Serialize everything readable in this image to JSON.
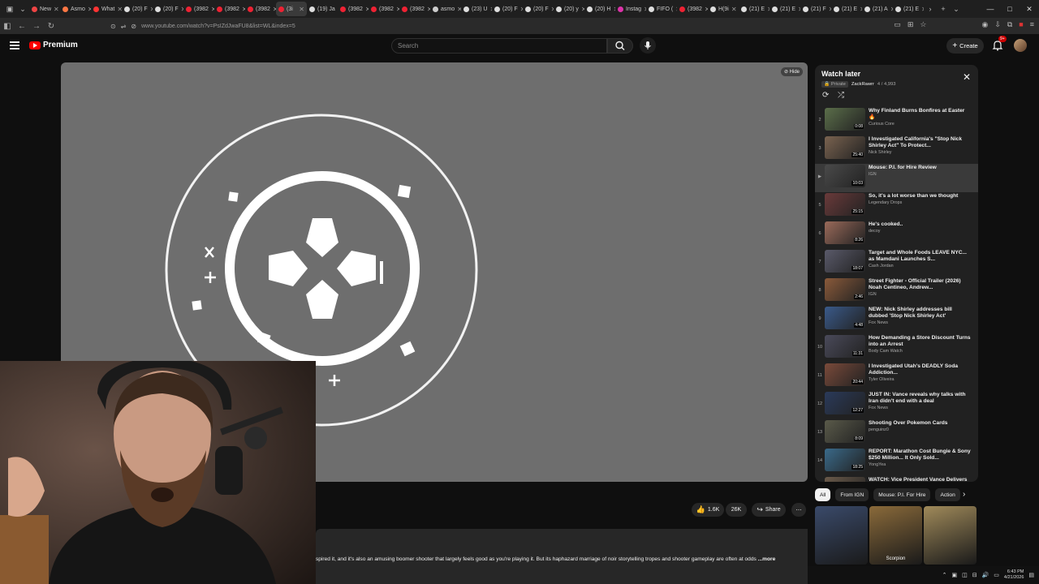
{
  "browser": {
    "tabs": [
      {
        "label": "New",
        "color": "#e44"
      },
      {
        "label": "Asmo",
        "color": "#f74"
      },
      {
        "label": "What",
        "color": "#f33"
      },
      {
        "label": "(20) F",
        "color": "#ddd"
      },
      {
        "label": "(20) F",
        "color": "#ddd"
      },
      {
        "label": "(3982",
        "color": "#e23"
      },
      {
        "label": "(3982",
        "color": "#e23"
      },
      {
        "label": "(3982",
        "color": "#e23"
      },
      {
        "label": "(3i",
        "color": "#e23"
      },
      {
        "label": "(19) Ja",
        "color": "#ddd"
      },
      {
        "label": "(3982",
        "color": "#e23"
      },
      {
        "label": "(3982",
        "color": "#e23"
      },
      {
        "label": "(3982",
        "color": "#e23"
      },
      {
        "label": "asmo",
        "color": "#ccc"
      },
      {
        "label": "(23) U",
        "color": "#ddd"
      },
      {
        "label": "(20) F",
        "color": "#ddd"
      },
      {
        "label": "(20) F",
        "color": "#ddd"
      },
      {
        "label": "(20) y",
        "color": "#ddd"
      },
      {
        "label": "(20) H",
        "color": "#ddd"
      },
      {
        "label": "Instag",
        "color": "#d3a"
      },
      {
        "label": "FIFO (",
        "color": "#ddd"
      },
      {
        "label": "(3982",
        "color": "#e23"
      },
      {
        "label": "H(9i",
        "color": "#ddd"
      },
      {
        "label": "(21) E",
        "color": "#ddd"
      },
      {
        "label": "(21) E",
        "color": "#ddd"
      },
      {
        "label": "(21) F",
        "color": "#ddd"
      },
      {
        "label": "(21) E",
        "color": "#ddd"
      },
      {
        "label": "(21) A",
        "color": "#ddd"
      },
      {
        "label": "(21) E",
        "color": "#ddd"
      }
    ],
    "active_tab_index": 8,
    "url": "www.youtube.com/watch?v=PsIZdJwaFU8&list=WL&index=5"
  },
  "header": {
    "logo": "Premium",
    "search_placeholder": "Search",
    "create": "Create",
    "notification_count": "9+"
  },
  "player": {
    "hide_label": "Hide"
  },
  "actions": {
    "likes": "1.6K",
    "dislike_count": "26K",
    "share": "Share"
  },
  "description": {
    "text": "spired it, and it's also an amusing boomer shooter that largely feels good as you're playing it. But its haphazard marriage of noir storytelling tropes and shooter gameplay are often at odds",
    "more": "...more"
  },
  "playlist": {
    "title": "Watch later",
    "privacy": "Private",
    "owner": "ZackRawrr",
    "position": "4 / 4,993",
    "items": [
      {
        "index": "2",
        "title": "Why Finland Burns Bonfires at Easter 🔥",
        "channel": "Curious Core",
        "duration": "0:08",
        "thumb": "#5b6e4a"
      },
      {
        "index": "3",
        "title": "I Investigated California's \"Stop Nick Shirley Act\" To Protect...",
        "channel": "Nick Shirley",
        "duration": "25:40",
        "thumb": "#7a6350"
      },
      {
        "index": "▶",
        "title": "Mouse: P.I. for Hire Review",
        "channel": "IGN",
        "duration": "10:03",
        "thumb": "#4a4a4a",
        "current": true
      },
      {
        "index": "5",
        "title": "So, it's a lot worse than we thought",
        "channel": "Legendary Drops",
        "duration": "25:15",
        "thumb": "#6a3a3a"
      },
      {
        "index": "6",
        "title": "He's cooked..",
        "channel": "decoy",
        "duration": "8:26",
        "thumb": "#9a6a5a"
      },
      {
        "index": "7",
        "title": "Target and Whole Foods LEAVE NYC... as Mamdani Launches S...",
        "channel": "Cash Jordan",
        "duration": "18:07",
        "thumb": "#5a5a6a"
      },
      {
        "index": "8",
        "title": "Street Fighter - Official Trailer (2026) Noah Centineo, Andrew...",
        "channel": "IGN",
        "duration": "2:46",
        "thumb": "#8a5a3a"
      },
      {
        "index": "9",
        "title": "NEW: Nick Shirley addresses bill dubbed 'Stop Nick Shirley Act'",
        "channel": "Fox News",
        "duration": "4:48",
        "thumb": "#3a5a8a"
      },
      {
        "index": "10",
        "title": "How Demanding a Store Discount Turns into an Arrest",
        "channel": "Body Cam Watch",
        "duration": "11:31",
        "thumb": "#4a4a5a"
      },
      {
        "index": "11",
        "title": "I Investigated Utah's DEADLY Soda Addiction...",
        "channel": "Tyler Oliveira",
        "duration": "20:44",
        "thumb": "#7a4a3a"
      },
      {
        "index": "12",
        "title": "JUST IN: Vance reveals why talks with Iran didn't end with a deal",
        "channel": "Fox News",
        "duration": "12:27",
        "thumb": "#2a3a5a"
      },
      {
        "index": "13",
        "title": "Shooting Over Pokemon Cards",
        "channel": "penguinz0",
        "duration": "8:09",
        "thumb": "#5a5a4a"
      },
      {
        "index": "14",
        "title": "REPORT: Marathon Cost Bungie & Sony $250 Million... It Only Sold...",
        "channel": "YongYea",
        "duration": "18:25",
        "thumb": "#3a6a8a"
      },
      {
        "index": "15",
        "title": "WATCH: Vice President Vance Delivers Remarks on High-Stake...",
        "channel": "",
        "duration": "",
        "thumb": "#6a5a4a"
      }
    ]
  },
  "chips": [
    {
      "label": "All",
      "active": true
    },
    {
      "label": "From IGN",
      "active": false
    },
    {
      "label": "Mouse: P.I. For Hire",
      "active": false
    },
    {
      "label": "Action",
      "active": false
    }
  ],
  "recommended": [
    {
      "label": "",
      "color": "#3a4a6a"
    },
    {
      "label": "Scorpion",
      "color": "#8a6a3a"
    },
    {
      "label": "",
      "color": "#a08a5a"
    }
  ],
  "taskbar": {
    "time": "6:43 PM",
    "date": "4/21/2026"
  }
}
